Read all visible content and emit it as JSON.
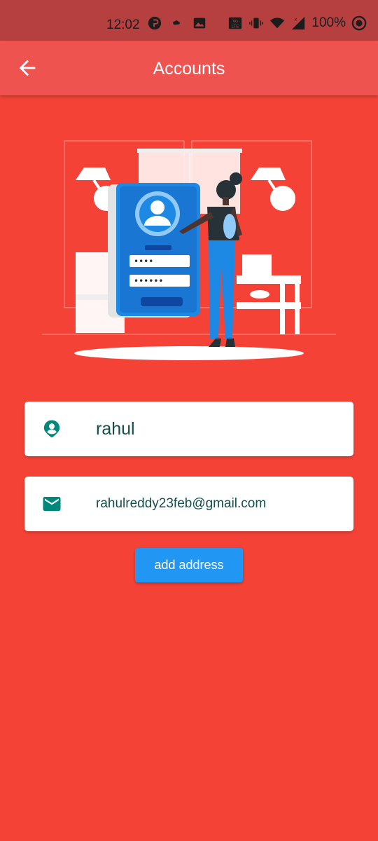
{
  "status_bar": {
    "time": "12:02",
    "battery": "100%",
    "icons": [
      "pinterest-icon",
      "cloud-icon",
      "image-icon",
      "volte-icon",
      "vibrate-icon",
      "wifi-icon",
      "signal-icon",
      "target-icon"
    ]
  },
  "app_bar": {
    "title": "Accounts",
    "back_icon": "arrow-back-icon"
  },
  "illustration": {
    "password_mask_1": "••••",
    "password_mask_2": "••••••"
  },
  "profile": {
    "name": "rahul",
    "email": "rahulreddy23feb@gmail.com",
    "name_icon": "account-pin-icon",
    "email_icon": "email-icon"
  },
  "actions": {
    "add_address_label": "add address"
  },
  "colors": {
    "background": "#f44336",
    "app_bar": "#ef5350",
    "status_bar": "#b64040",
    "button": "#2196f3",
    "icon_teal": "#00897b",
    "text_dark_teal": "#134e4a"
  }
}
